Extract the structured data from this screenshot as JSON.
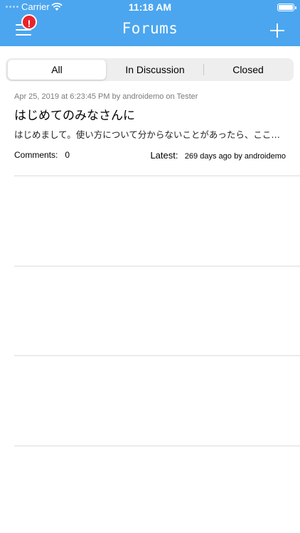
{
  "status_bar": {
    "carrier": "Carrier",
    "time": "11:18 AM"
  },
  "header": {
    "title": "Forums",
    "badge": "!"
  },
  "tabs": [
    {
      "label": "All",
      "active": true
    },
    {
      "label": "In Discussion",
      "active": false
    },
    {
      "label": "Closed",
      "active": false
    }
  ],
  "posts": [
    {
      "meta": "Apr 25, 2019 at 6:23:45 PM by androidemo  on Tester",
      "title": "はじめてのみなさんに",
      "body": "はじめまして。使い方について分からないことがあったら、ここ…",
      "comments_label": "Comments:",
      "comments_count": "0",
      "latest_label": "Latest:",
      "latest_time": "269 days ago",
      "latest_by": "by androidemo"
    }
  ],
  "colors": {
    "header": "#4ba6ef",
    "badge": "#e8232b"
  }
}
